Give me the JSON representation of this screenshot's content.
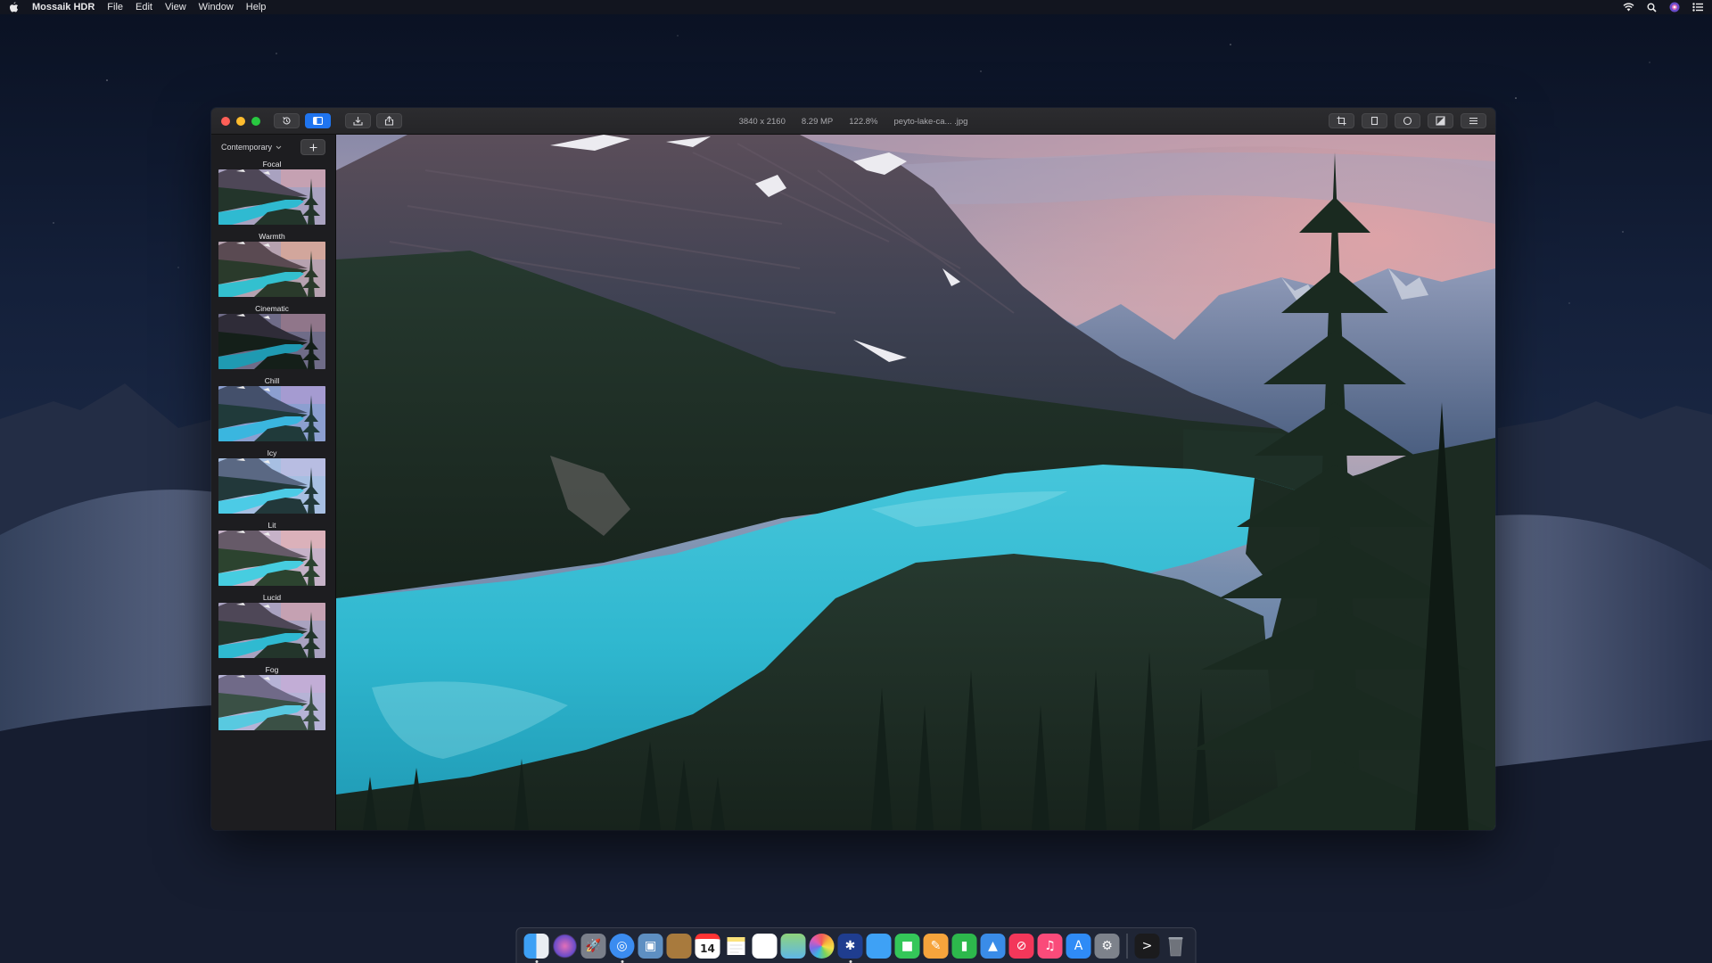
{
  "menubar": {
    "app_name": "Mossaik HDR",
    "items": [
      "File",
      "Edit",
      "View",
      "Window",
      "Help"
    ]
  },
  "window": {
    "info": {
      "dimensions": "3840 x 2160",
      "megapixels": "8.29 MP",
      "zoom": "122.8%",
      "filename": "peyto-lake-ca... .jpg"
    },
    "sidebar": {
      "dropdown_label": "Contemporary",
      "presets": [
        {
          "label": "Focal",
          "tone": "normal"
        },
        {
          "label": "Warmth",
          "tone": "warm"
        },
        {
          "label": "Cinematic",
          "tone": "dark"
        },
        {
          "label": "Chill",
          "tone": "cool"
        },
        {
          "label": "Icy",
          "tone": "icy"
        },
        {
          "label": "Lit",
          "tone": "bright"
        },
        {
          "label": "Lucid",
          "tone": "normal"
        },
        {
          "label": "Fog",
          "tone": "fog"
        }
      ]
    }
  },
  "dock": {
    "apps": [
      "finder",
      "siri",
      "launchpad",
      "safari",
      "preview",
      "notefile",
      "calendar",
      "notes",
      "reminders",
      "maps",
      "photos",
      "mossaik",
      "messages",
      "facetime",
      "pages",
      "numbers",
      "keynote",
      "news",
      "itunes",
      "app-store",
      "system-preferences",
      "terminal",
      "trash"
    ],
    "calendar_day": "14"
  },
  "colors": {
    "accent": "#1f74ef",
    "lake": "#2fb7cf"
  }
}
